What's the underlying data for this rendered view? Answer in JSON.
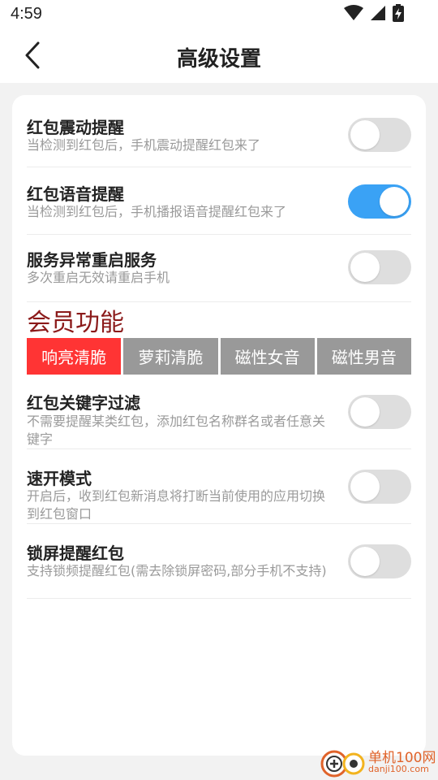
{
  "status_bar": {
    "time": "4:59",
    "icons": [
      "wifi-icon",
      "signal-icon",
      "battery-charging-icon"
    ]
  },
  "header": {
    "title": "高级设置",
    "back_icon": "chevron-left-icon"
  },
  "settings": [
    {
      "title": "红包震动提醒",
      "desc": "当检测到红包后，手机震动提醒红包来了",
      "enabled": false
    },
    {
      "title": "红包语音提醒",
      "desc": "当检测到红包后，手机播报语音提醒红包来了",
      "enabled": true
    },
    {
      "title": "服务异常重启服务",
      "desc": "多次重启无效请重启手机",
      "enabled": false
    }
  ],
  "member": {
    "title": "会员功能",
    "voices": [
      {
        "label": "响亮清脆",
        "selected": true
      },
      {
        "label": "萝莉清脆",
        "selected": false
      },
      {
        "label": "磁性女音",
        "selected": false
      },
      {
        "label": "磁性男音",
        "selected": false
      }
    ]
  },
  "member_settings": [
    {
      "title": "红包关键字过滤",
      "desc": "不需要提醒某类红包，添加红包名称群名或者任意关键字",
      "enabled": false
    },
    {
      "title": "速开模式",
      "desc": "开启后，收到红包新消息将打断当前使用的应用切换到红包窗口",
      "enabled": false
    },
    {
      "title": "锁屏提醒红包",
      "desc": "支持锁频提醒红包(需去除锁屏密码,部分手机不支持)",
      "enabled": false
    }
  ],
  "watermark": {
    "name": "单机100网",
    "url": "danji100.com"
  },
  "colors": {
    "accent": "#3aa2f5",
    "selected": "#ff3434",
    "member_title": "#8b1a1a",
    "toggle_off": "#dedede"
  }
}
